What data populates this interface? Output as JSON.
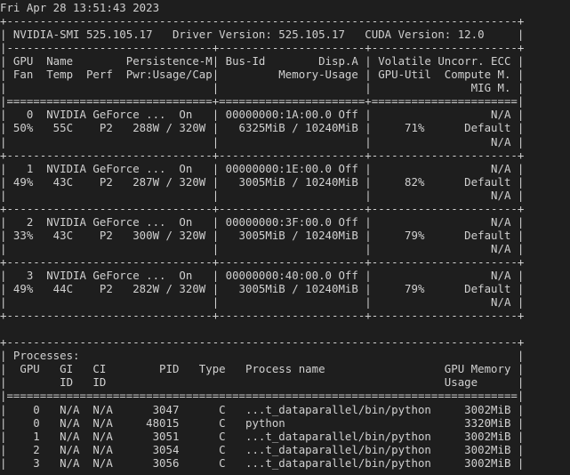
{
  "terminal": {
    "lines": [
      "Fri Apr 28 13:51:43 2023",
      "+-----------------------------------------------------------------------------+",
      "| NVIDIA-SMI 525.105.17   Driver Version: 525.105.17   CUDA Version: 12.0     |",
      "|-------------------------------+----------------------+----------------------+",
      "| GPU  Name        Persistence-M| Bus-Id        Disp.A | Volatile Uncorr. ECC |",
      "| Fan  Temp  Perf  Pwr:Usage/Cap|         Memory-Usage | GPU-Util  Compute M. |",
      "|                               |                      |               MIG M. |",
      "|===============================+======================+======================|",
      "|   0  NVIDIA GeForce ...  On   | 00000000:1A:00.0 Off |                  N/A |",
      "| 50%   55C    P2   288W / 320W |   6325MiB / 10240MiB |     71%      Default |",
      "|                               |                      |                  N/A |",
      "+-------------------------------+----------------------+----------------------+",
      "|   1  NVIDIA GeForce ...  On   | 00000000:1E:00.0 Off |                  N/A |",
      "| 49%   43C    P2   287W / 320W |   3005MiB / 10240MiB |     82%      Default |",
      "|                               |                      |                  N/A |",
      "+-------------------------------+----------------------+----------------------+",
      "|   2  NVIDIA GeForce ...  On   | 00000000:3F:00.0 Off |                  N/A |",
      "| 33%   43C    P2   300W / 320W |   3005MiB / 10240MiB |     79%      Default |",
      "|                               |                      |                  N/A |",
      "+-------------------------------+----------------------+----------------------+",
      "|   3  NVIDIA GeForce ...  On   | 00000000:40:00.0 Off |                  N/A |",
      "| 49%   44C    P2   282W / 320W |   3005MiB / 10240MiB |     79%      Default |",
      "|                               |                      |                  N/A |",
      "+-------------------------------+----------------------+----------------------+",
      "",
      "+-----------------------------------------------------------------------------+",
      "| Processes:                                                                  |",
      "|  GPU   GI   CI        PID   Type   Process name                  GPU Memory |",
      "|        ID   ID                                                   Usage      |",
      "|=============================================================================|",
      "|    0   N/A  N/A      3047      C   ...t_dataparallel/bin/python     3002MiB |",
      "|    0   N/A  N/A     48015      C   python                           3320MiB |",
      "|    1   N/A  N/A      3051      C   ...t_dataparallel/bin/python     3002MiB |",
      "|    2   N/A  N/A      3054      C   ...t_dataparallel/bin/python     3002MiB |",
      "|    3   N/A  N/A      3056      C   ...t_dataparallel/bin/python     3002MiB |"
    ]
  }
}
